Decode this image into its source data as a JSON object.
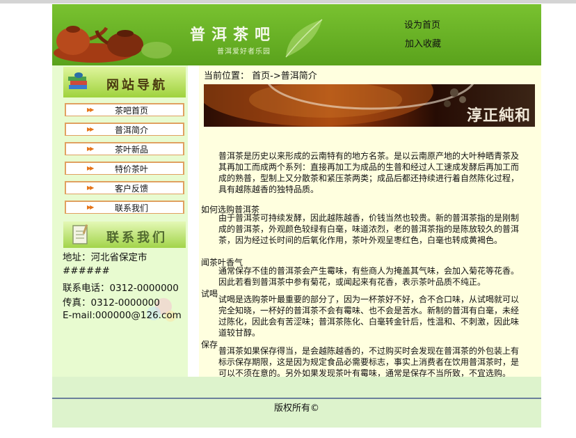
{
  "header": {
    "title": "普洱茶吧",
    "slogan": "普洱爱好者乐园",
    "links": [
      "设为首页",
      "加入收藏"
    ]
  },
  "sidebar": {
    "nav_banner": "网站导航",
    "nav_items": [
      "茶吧首页",
      "普洱简介",
      "茶叶新品",
      "特价茶叶",
      "客户反馈",
      "联系我们"
    ],
    "contact_banner": "联系我们",
    "contact_lines": [
      "地址：河北省保定市",
      "######",
      "联系电话：0312-0000000",
      "传真：0312-0000000",
      "E-mail:000000@126.com"
    ]
  },
  "main": {
    "breadcrumb": "当前位置：  首页->普洱简介",
    "banner_text": "淳正純和",
    "intro": "普洱茶是历史以来形成的云南特有的地方名茶。是以云南原产地的大叶种晒青茶及其再加工而成两个系列：直接再加工为成品的生普和经过人工速成发酵后再加工而成的熟普，型制上又分散茶和紧压茶两类；成品后都还持续进行着自然陈化过程，具有越陈越香的独特品质。",
    "sections": [
      {
        "title": "如何选购普洱茶",
        "text": "由于普洱茶可持续发酵，因此越陈越香，价钱当然也较贵。新的普洱茶指的是刚制成的普洱茶，外观颜色较绿有白毫，味道浓烈，老的普洱茶指的是陈放较久的普洱茶，因为经过长时间的后氧化作用，茶叶外观呈枣红色，白毫也转成黄褐色。"
      },
      {
        "title": "闻茶叶香气",
        "text": "通常保存不佳的普洱茶会产生霉味，有些商人为掩盖其气味，会加入菊花等花香。因此若看到普洱茶中参有菊花，或闻起来有花香，表示茶叶品质不纯正。"
      },
      {
        "title": "试喝",
        "text": "试喝是选购茶叶最重要的部分了，因为一杯茶好不好，合不合口味，从试喝就可以完全知晓，一杯好的普洱茶不会有霉味、也不会是苦水。新制的普洱有白毫，未经过陈化，因此会有苦涩味；普洱茶陈化、白毫转金针后，性温和、不刺激，因此味道较甘醇。"
      },
      {
        "title": "保存",
        "text": "普洱茶如果保存得当，是会越陈越香的，不过购买时会发现在普洱茶的外包装上有标示保存期限，这是因为规定食品必需要标志，事实上消费者在饮用普洱茶时，是可以不须在意的。另外如果发现茶叶有霉味，通常是保存不当所致，不宜选购。"
      }
    ]
  },
  "footer": {
    "copyright": "版权所有©"
  },
  "colors": {
    "header_green": "#5aa21c",
    "sidebar_bg": "#e8fbd0",
    "main_bg": "#ffffdf",
    "footer_bg": "#ddf3cc",
    "nav_border": "#e0a060",
    "arrow": "#e5741a"
  }
}
